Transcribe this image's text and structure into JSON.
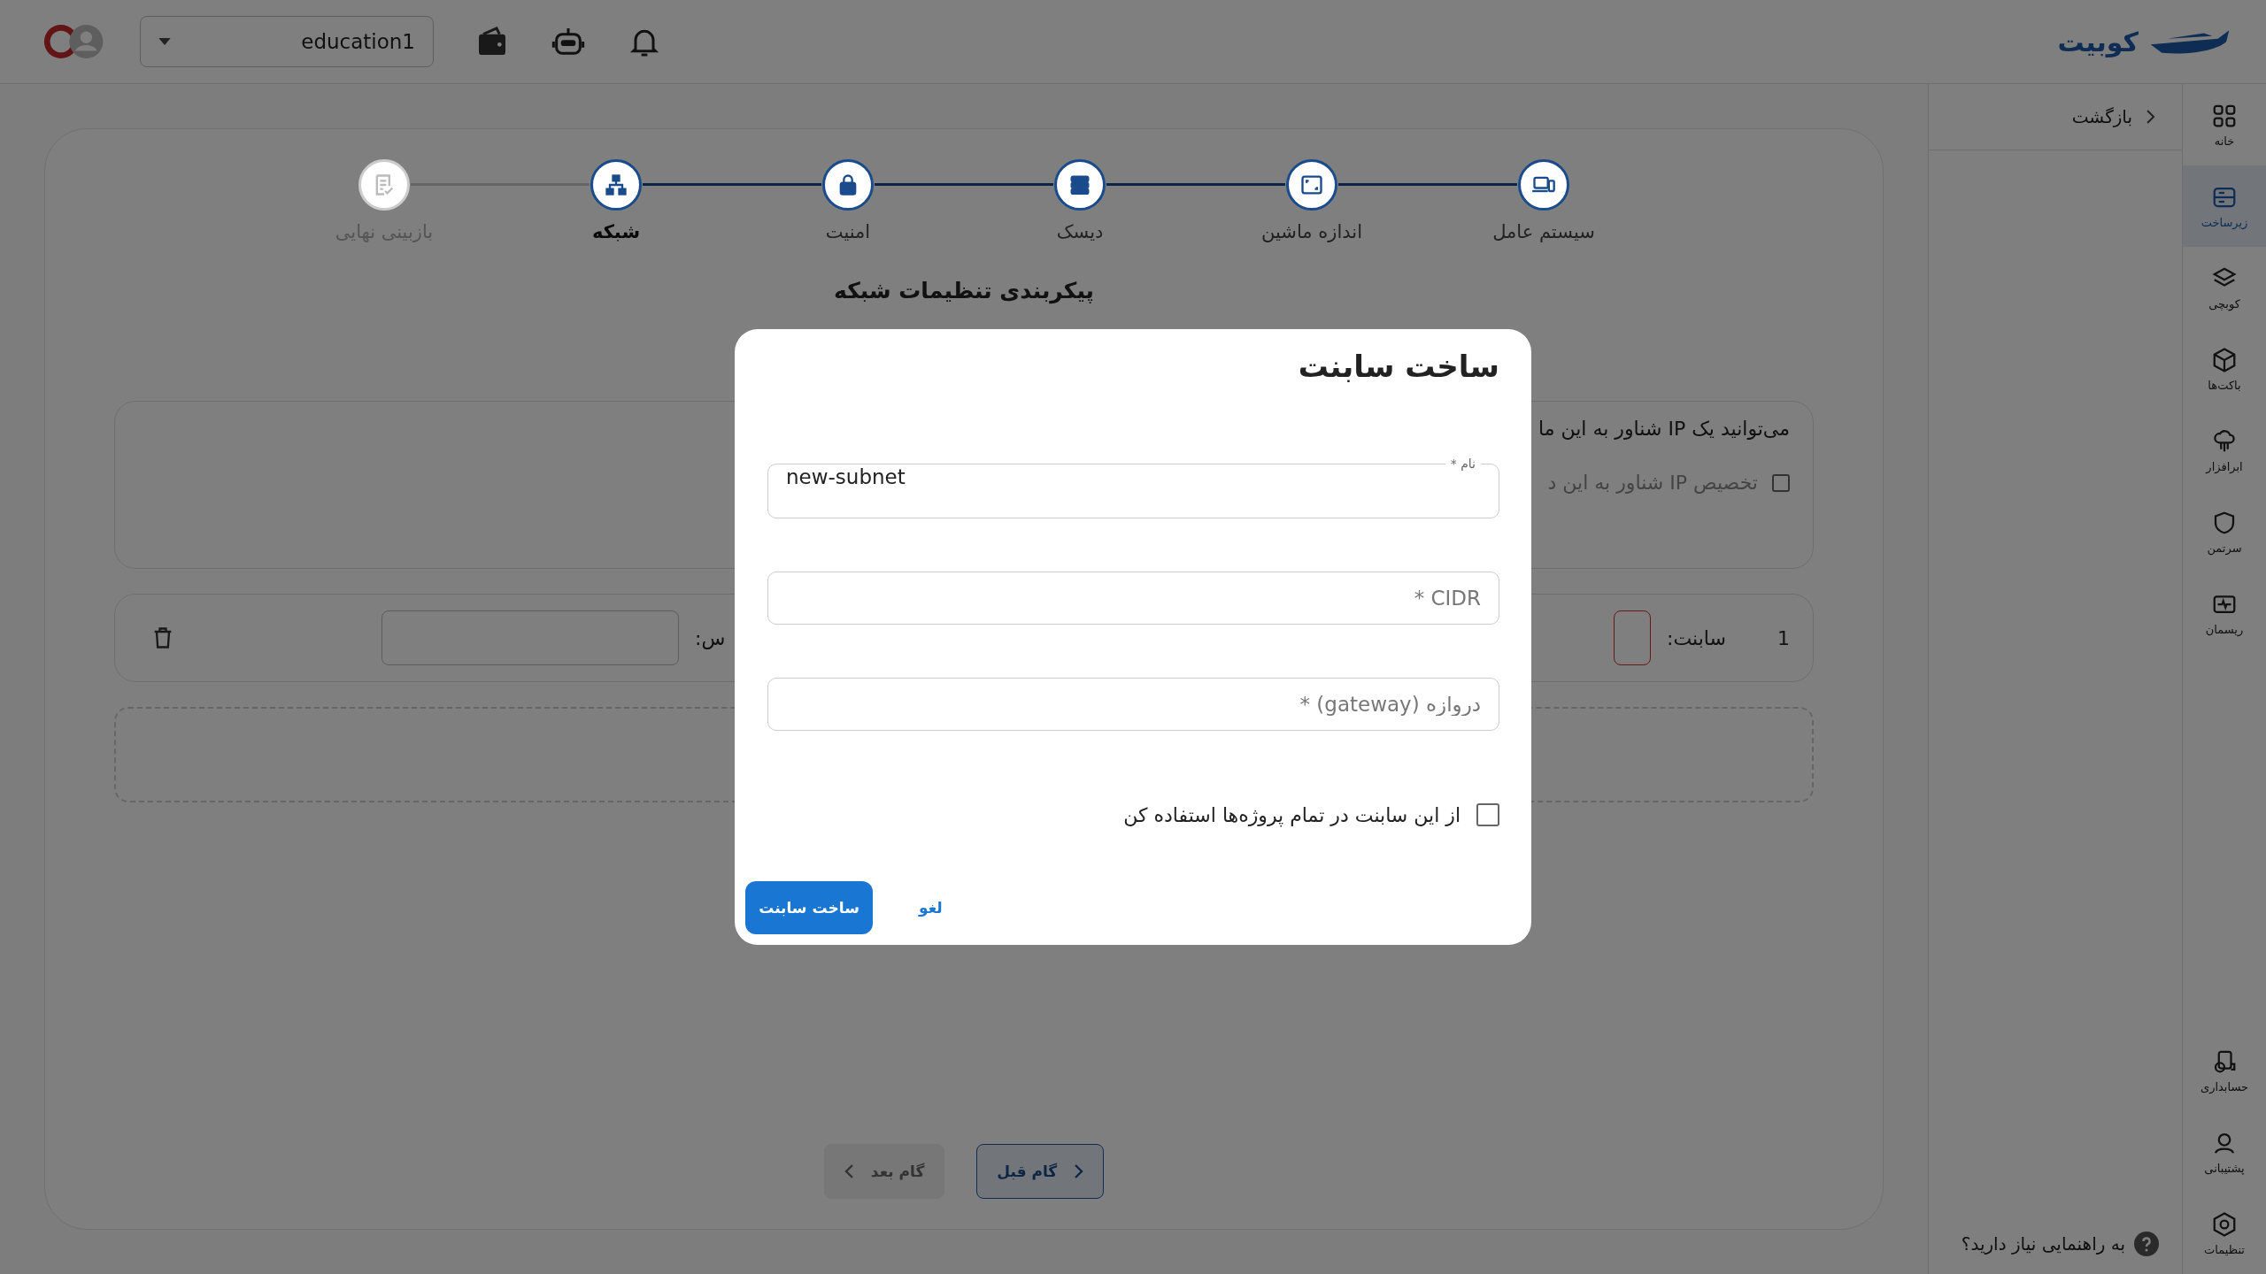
{
  "topbar": {
    "logo": "کوبیت",
    "project": "education1"
  },
  "nav_rail": {
    "items": [
      {
        "label": "خانه",
        "selected": false
      },
      {
        "label": "زیرساخت",
        "selected": true
      },
      {
        "label": "کوبچی",
        "selected": false
      },
      {
        "label": "باکت‌ها",
        "selected": false
      },
      {
        "label": "ابرافزار",
        "selected": false
      },
      {
        "label": "سرتمن",
        "selected": false
      },
      {
        "label": "ریسمان",
        "selected": false
      }
    ],
    "bottom_items": [
      {
        "label": "حسابداری",
        "selected": false
      },
      {
        "label": "پشتیبانی",
        "selected": false
      },
      {
        "label": "تنظیمات",
        "selected": false
      }
    ]
  },
  "sidebar": {
    "back": "بازگشت",
    "help": "به راهنمایی نیاز دارید؟"
  },
  "stepper": [
    {
      "label": "سیستم عامل",
      "completed": true,
      "selected": false
    },
    {
      "label": "اندازه ماشین",
      "completed": true,
      "selected": false
    },
    {
      "label": "دیسک",
      "completed": true,
      "selected": false
    },
    {
      "label": "امنیت",
      "completed": true,
      "selected": false
    },
    {
      "label": "شبکه",
      "completed": false,
      "selected": true
    },
    {
      "label": "بازبینی نهایی",
      "completed": false,
      "selected": false
    }
  ],
  "heading": "پیکربندی تنظیمات شبکه",
  "floating_ip": {
    "text": "می‌توانید یک IP شناور به این ما",
    "checkbox_label": "تخصیص IP شناور به این د",
    "checked": false
  },
  "subnet_row": {
    "index": "1",
    "subnet_label": "سابنت:",
    "address_label": "س:"
  },
  "nav_buttons": {
    "previous": "گام قبل",
    "next": "گام بعد",
    "next_disabled": true
  },
  "dialog": {
    "title": "ساخت سابنت",
    "fields": [
      {
        "label": "نام *",
        "value": "new-subnet"
      },
      {
        "placeholder": "CIDR *"
      },
      {
        "placeholder": "دروازه (gateway) *"
      }
    ],
    "share": {
      "label": "از این سابنت در تمام پروژه‌ها استفاده کن",
      "checked": false
    },
    "submit": "ساخت سابنت",
    "cancel": "لغو"
  }
}
